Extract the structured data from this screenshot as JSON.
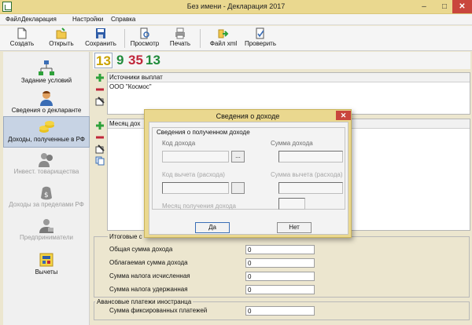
{
  "window": {
    "title": "Без имени - Декларация 2017",
    "min": "–",
    "max": "□",
    "close": "✕"
  },
  "menu": [
    "Файл",
    "Декларация",
    "Настройки",
    "Справка"
  ],
  "toolbar": [
    {
      "label": "Создать",
      "icon": "new-file-icon"
    },
    {
      "label": "Открыть",
      "icon": "open-folder-icon"
    },
    {
      "label": "Сохранить",
      "icon": "save-icon"
    },
    {
      "label": "Просмотр",
      "icon": "preview-icon"
    },
    {
      "label": "Печать",
      "icon": "printer-icon"
    },
    {
      "label": "Файл xml",
      "icon": "xml-export-icon"
    },
    {
      "label": "Проверить",
      "icon": "check-icon"
    }
  ],
  "nav": [
    {
      "label": "Задание условий",
      "icon": "conditions-icon",
      "state": "normal"
    },
    {
      "label": "Сведения о декларанте",
      "icon": "declarant-icon",
      "state": "normal"
    },
    {
      "label": "Доходы, полученные в РФ",
      "icon": "income-coins-icon",
      "state": "active"
    },
    {
      "label": "Инвест. товарищества",
      "icon": "investment-icon",
      "state": "disabled"
    },
    {
      "label": "Доходы за пределами РФ",
      "icon": "foreign-income-icon",
      "state": "disabled"
    },
    {
      "label": "Предприниматели",
      "icon": "entrepreneur-icon",
      "state": "disabled"
    },
    {
      "label": "Вычеты",
      "icon": "deductions-icon",
      "state": "normal"
    }
  ],
  "tabs": [
    {
      "label": "13",
      "color": "#c9a200",
      "active": true
    },
    {
      "label": "9",
      "color": "#1f8a3a",
      "active": false
    },
    {
      "label": "35",
      "color": "#c0263a",
      "active": false
    },
    {
      "label": "13",
      "color": "#1f8a3a",
      "active": false
    }
  ],
  "sources": {
    "header": "Источники выплат",
    "rows": [
      "ООО \"Космос\""
    ]
  },
  "months": {
    "header": "Месяц дох"
  },
  "totals": {
    "legend": "Итоговые с",
    "rows": [
      {
        "label": "Общая сумма дохода",
        "value": "0"
      },
      {
        "label": "Облагаемая сумма дохода",
        "value": "0"
      },
      {
        "label": "Сумма налога исчисленная",
        "value": "0"
      },
      {
        "label": "Сумма налога удержанная",
        "value": "0"
      }
    ]
  },
  "advance": {
    "legend": "Авансовые платежи иностранца",
    "label": "Сумма фиксированных платежей",
    "value": "0"
  },
  "dialog": {
    "title": "Сведения о доходе",
    "close": "✕",
    "legend": "Сведения о полученном доходе",
    "income_code": "Код дохода",
    "income_sum": "Сумма дохода",
    "deduction_code": "Код вычета (расхода)",
    "deduction_sum": "Сумма вычета (расхода)",
    "month": "Месяц получения дохода",
    "pick": "...",
    "ok": "Да",
    "cancel": "Нет"
  },
  "colors": {
    "titlebar": "#ead88f",
    "close": "#c9463d",
    "nav_active": "#c7d3e4",
    "plus": "#2ea13a",
    "minus": "#c0263a"
  }
}
